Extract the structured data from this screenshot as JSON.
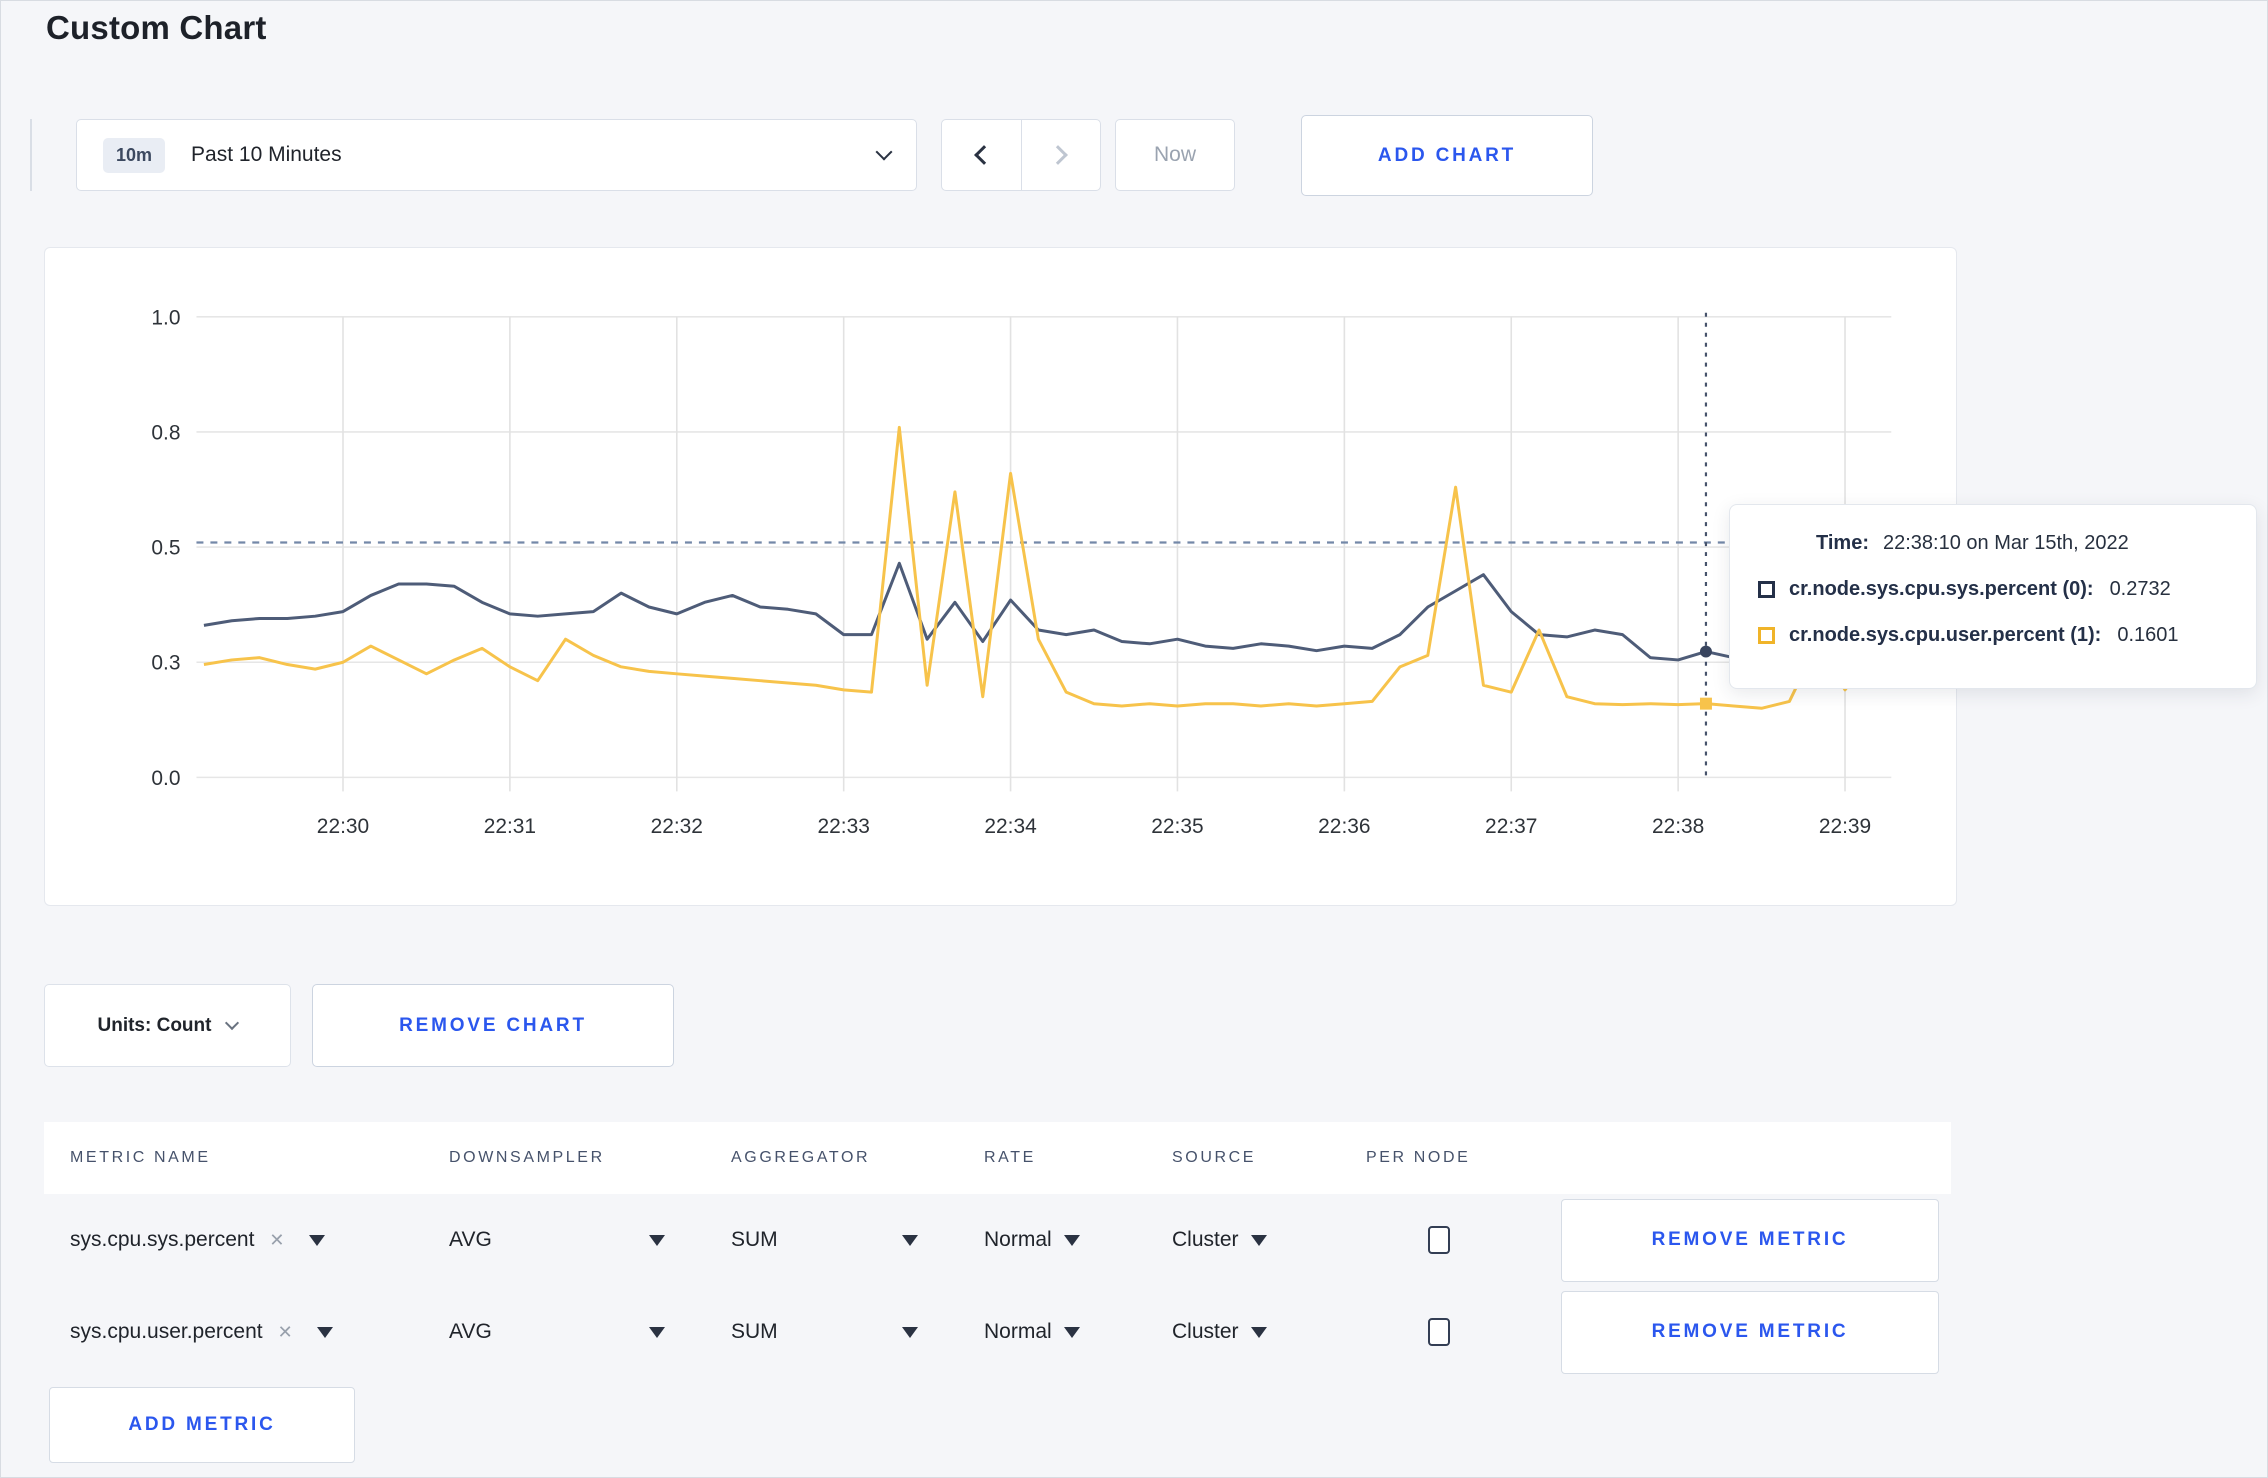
{
  "page": {
    "title": "Custom Chart"
  },
  "toolbar": {
    "time_range": {
      "badge": "10m",
      "label": "Past 10 Minutes"
    },
    "now_label": "Now",
    "add_chart_label": "ADD CHART"
  },
  "chart_data": {
    "type": "line",
    "title": "",
    "xlabel": "",
    "ylabel": "",
    "ylim": [
      0,
      1
    ],
    "grid": true,
    "legend_position": "tooltip",
    "x_start": "22:29:10",
    "interval_seconds": 10,
    "x_ticks": [
      "22:30",
      "22:31",
      "22:32",
      "22:33",
      "22:34",
      "22:35",
      "22:36",
      "22:37",
      "22:38",
      "22:39"
    ],
    "y_ticks": [
      {
        "value": 1.0,
        "label": "1.0"
      },
      {
        "value": 0.75,
        "label": "0.8"
      },
      {
        "value": 0.5,
        "label": "0.5"
      },
      {
        "value": 0.25,
        "label": "0.3"
      },
      {
        "value": 0.0,
        "label": "0.0"
      }
    ],
    "max_line": {
      "value": 0.51
    },
    "crosshair": {
      "index": 54,
      "time": "22:38:10"
    },
    "series": [
      {
        "name": "cr.node.sys.cpu.sys.percent (0)",
        "color": "#4e5c78",
        "marker": "circle",
        "values": [
          0.33,
          0.34,
          0.345,
          0.345,
          0.35,
          0.36,
          0.395,
          0.42,
          0.42,
          0.415,
          0.38,
          0.355,
          0.35,
          0.355,
          0.36,
          0.4,
          0.37,
          0.355,
          0.38,
          0.395,
          0.37,
          0.365,
          0.355,
          0.31,
          0.31,
          0.465,
          0.3,
          0.38,
          0.295,
          0.385,
          0.32,
          0.31,
          0.32,
          0.295,
          0.29,
          0.3,
          0.285,
          0.28,
          0.29,
          0.285,
          0.275,
          0.285,
          0.28,
          0.31,
          0.37,
          0.405,
          0.44,
          0.36,
          0.31,
          0.305,
          0.32,
          0.31,
          0.26,
          0.255,
          0.2732,
          0.26,
          0.27,
          0.3,
          0.295,
          0.3,
          0.3
        ]
      },
      {
        "name": "cr.node.sys.cpu.user.percent (1)",
        "color": "#f7c34b",
        "marker": "square",
        "values": [
          0.245,
          0.255,
          0.26,
          0.245,
          0.235,
          0.25,
          0.285,
          0.255,
          0.225,
          0.255,
          0.28,
          0.24,
          0.21,
          0.3,
          0.265,
          0.24,
          0.23,
          0.225,
          0.22,
          0.215,
          0.21,
          0.205,
          0.2,
          0.19,
          0.185,
          0.76,
          0.2,
          0.62,
          0.175,
          0.66,
          0.3,
          0.185,
          0.16,
          0.155,
          0.16,
          0.155,
          0.16,
          0.16,
          0.155,
          0.16,
          0.155,
          0.16,
          0.165,
          0.24,
          0.265,
          0.63,
          0.2,
          0.185,
          0.32,
          0.175,
          0.16,
          0.158,
          0.16,
          0.158,
          0.1601,
          0.155,
          0.15,
          0.165,
          0.29,
          0.19,
          0.27
        ]
      }
    ]
  },
  "tooltip": {
    "time_label": "Time:",
    "time_value": "22:38:10 on Mar 15th, 2022",
    "rows": [
      {
        "name": "cr.node.sys.cpu.sys.percent (0):",
        "value": "0.2732",
        "color": "#243048"
      },
      {
        "name": "cr.node.sys.cpu.user.percent (1):",
        "value": "0.1601",
        "color": "#f0b429"
      }
    ]
  },
  "chart_controls": {
    "units_label": "Units: Count",
    "remove_chart_label": "REMOVE CHART"
  },
  "metrics_table": {
    "headers": [
      "METRIC NAME",
      "DOWNSAMPLER",
      "AGGREGATOR",
      "RATE",
      "SOURCE",
      "PER NODE"
    ],
    "remove_icon": "✕",
    "rows": [
      {
        "metric": "sys.cpu.sys.percent",
        "downsampler": "AVG",
        "aggregator": "SUM",
        "rate": "Normal",
        "source": "Cluster",
        "per_node_checked": false,
        "remove_label": "REMOVE METRIC"
      },
      {
        "metric": "sys.cpu.user.percent",
        "downsampler": "AVG",
        "aggregator": "SUM",
        "rate": "Normal",
        "source": "Cluster",
        "per_node_checked": false,
        "remove_label": "REMOVE METRIC"
      }
    ],
    "add_metric_label": "ADD METRIC"
  },
  "colors": {
    "accent_blue": "#2b57ee",
    "series_sys": "#4e5c78",
    "series_user": "#f7c34b",
    "page_background": "#f5f6f9"
  }
}
